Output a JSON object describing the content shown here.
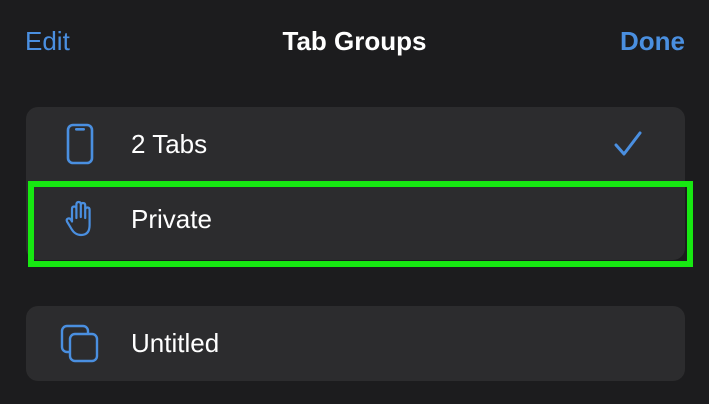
{
  "nav": {
    "edit_label": "Edit",
    "title": "Tab Groups",
    "done_label": "Done"
  },
  "tab_groups": [
    {
      "label": "2 Tabs",
      "icon": "iphone-icon",
      "selected": true
    },
    {
      "label": "Private",
      "icon": "hand-raised-icon",
      "selected": false,
      "highlighted": true
    },
    {
      "label": "Untitled",
      "icon": "square-on-square-icon",
      "selected": false
    }
  ],
  "colors": {
    "background": "#1c1c1e",
    "group_background": "#2c2c2e",
    "accent": "#4a8fe0",
    "highlight": "#17e812",
    "text": "#ffffff"
  }
}
